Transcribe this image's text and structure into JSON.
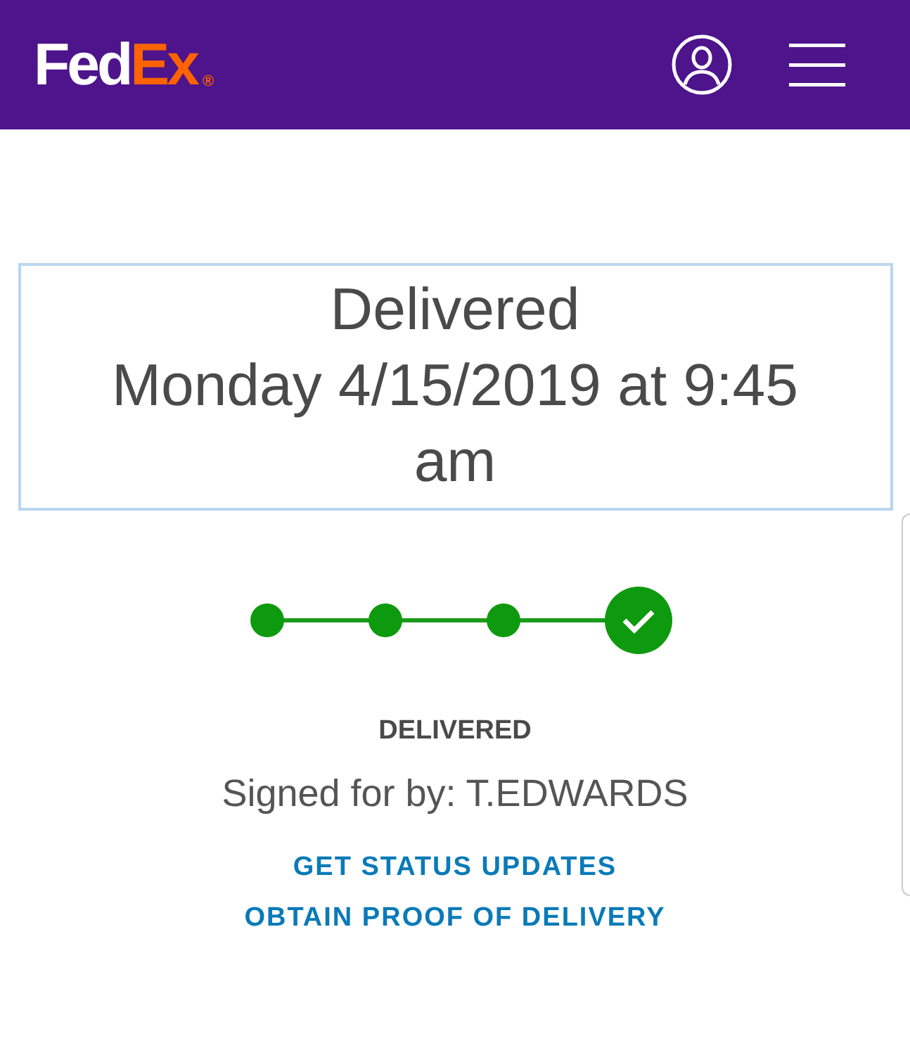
{
  "header": {
    "logo": {
      "parts": [
        "Fed",
        "Ex"
      ],
      "mark": "®"
    }
  },
  "delivery": {
    "title": "Delivered",
    "datetime": "Monday 4/15/2019 at 9:45 am"
  },
  "progress": {
    "steps": [
      {
        "kind": "dot"
      },
      {
        "kind": "dot"
      },
      {
        "kind": "dot"
      },
      {
        "kind": "check"
      }
    ]
  },
  "status": {
    "label": "DELIVERED",
    "signed": "Signed for by: T.EDWARDS"
  },
  "links": [
    "GET STATUS UPDATES",
    "OBTAIN PROOF OF DELIVERY"
  ]
}
